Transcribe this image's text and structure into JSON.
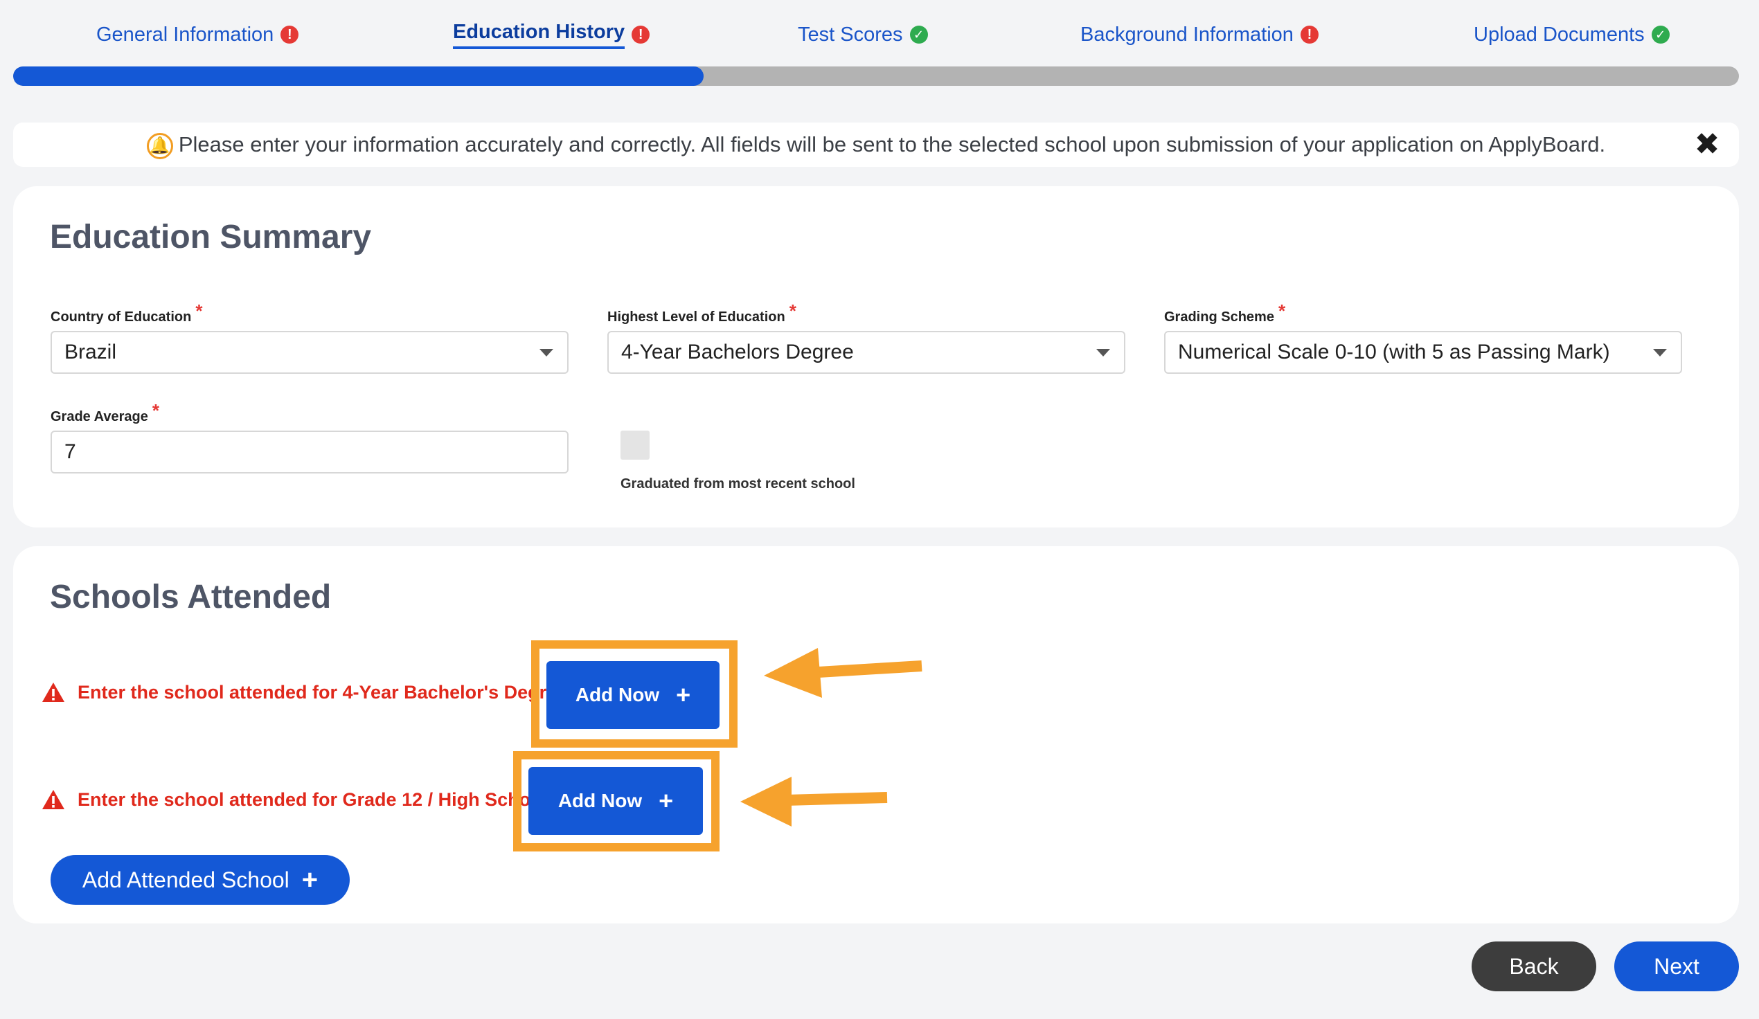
{
  "steps": [
    {
      "label": "General Information",
      "status": "error"
    },
    {
      "label": "Education History",
      "status": "error",
      "active": true
    },
    {
      "label": "Test Scores",
      "status": "complete"
    },
    {
      "label": "Background Information",
      "status": "error"
    },
    {
      "label": "Upload Documents",
      "status": "complete"
    }
  ],
  "progress": {
    "fraction": 0.4
  },
  "notice": {
    "text": "Please enter your information accurately and correctly. All fields will be sent to the selected school upon submission of your application on ApplyBoard.",
    "icon": "bell-icon",
    "close": "✖"
  },
  "education_summary": {
    "title": "Education Summary",
    "country_label": "Country of Education",
    "country_value": "Brazil",
    "level_label": "Highest Level of Education",
    "level_value": "4-Year Bachelors Degree",
    "grading_label": "Grading Scheme",
    "grading_value": "Numerical Scale 0-10 (with 5 as Passing Mark)",
    "average_label": "Grade Average",
    "average_value": "7",
    "graduated_label": "Graduated from most recent school",
    "required_mark": "*"
  },
  "schools_attended": {
    "title": "Schools Attended",
    "warning_1": "Enter the school attended for 4-Year Bachelor's Degree",
    "warning_2": "Enter the school attended for Grade 12 / High School",
    "add_now_label": "Add Now",
    "add_attended_label": "Add Attended School",
    "plus": "+"
  },
  "footer": {
    "back_label": "Back",
    "next_label": "Next"
  },
  "colors": {
    "primary": "#1458d6",
    "error": "#e53935",
    "success": "#2eab4f",
    "highlight": "#f6a22d",
    "back_button": "#3d3d3d"
  }
}
